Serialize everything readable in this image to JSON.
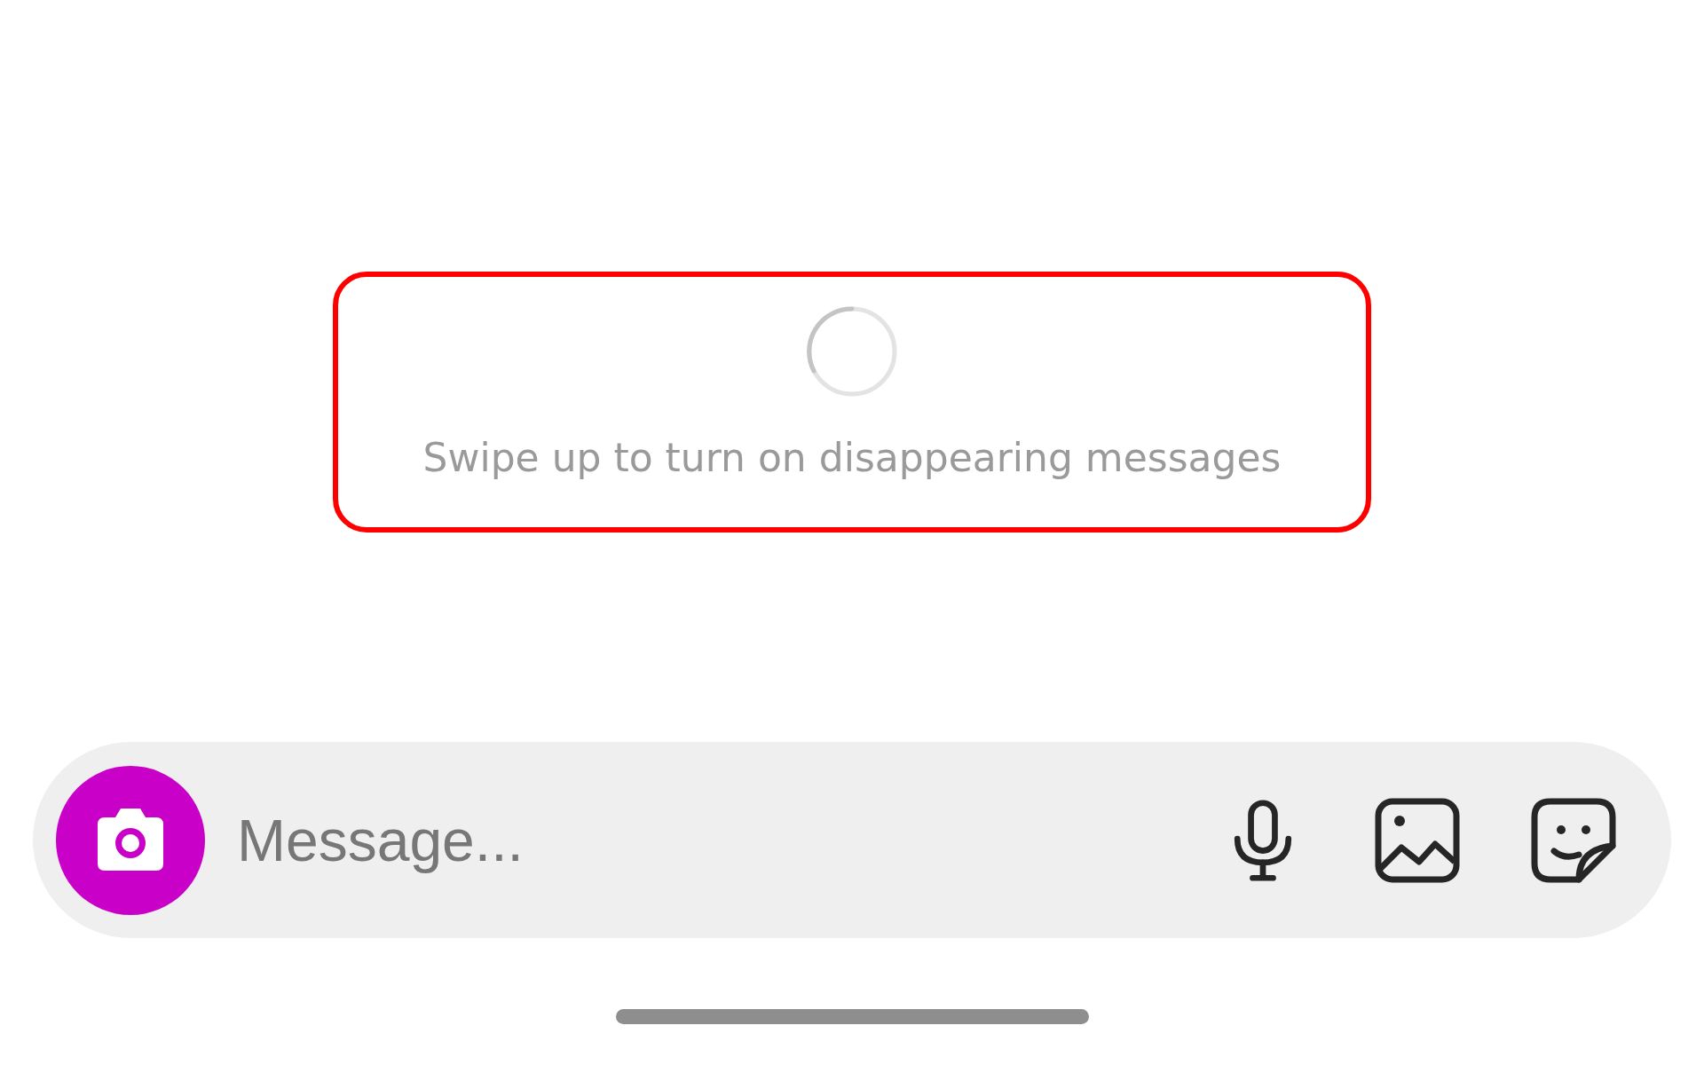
{
  "notice": {
    "text": "Swipe up to turn on disappearing messages"
  },
  "composer": {
    "placeholder": "Message..."
  }
}
